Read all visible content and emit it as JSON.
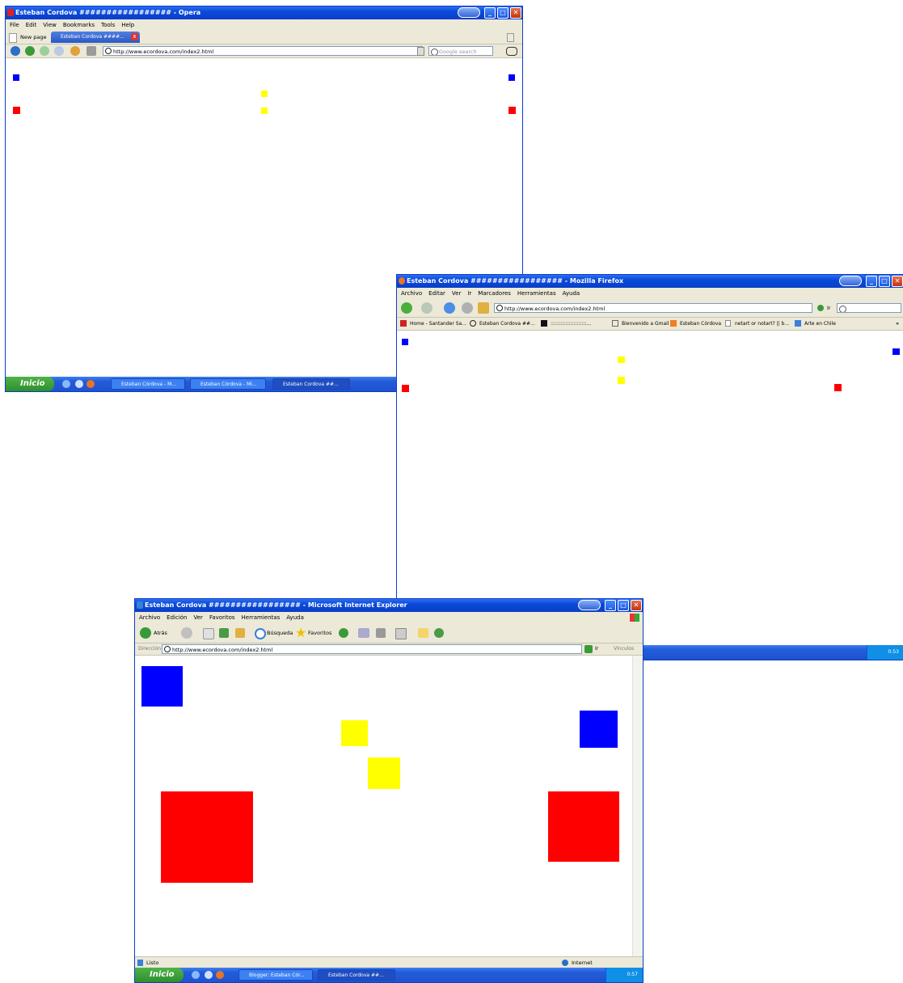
{
  "colors": {
    "blue": "#0000ff",
    "red": "#ff0000",
    "yellow": "#ffff00",
    "xp_title": "#0a49d8",
    "xp_start": "#2e8f2c"
  },
  "opera": {
    "title": "Esteban Cordova ################# - Opera",
    "menu": [
      "File",
      "Edit",
      "View",
      "Bookmarks",
      "Tools",
      "Help"
    ],
    "tabs": {
      "new_page": "New page",
      "active": "Esteban Cordova ####..."
    },
    "address": "http://www.ecordova.com/index2.html",
    "search_placeholder": "Google search",
    "taskbar": {
      "start": "Inicio",
      "items": [
        "Esteban Córdova - M...",
        "Esteban Córdova - Mi...",
        "Esteban Cordova ##..."
      ]
    }
  },
  "firefox": {
    "title": "Esteban Cordova ################# - Mozilla Firefox",
    "menu": [
      "Archivo",
      "Editar",
      "Ver",
      "Ir",
      "Marcadores",
      "Herramientas",
      "Ayuda"
    ],
    "address": "http://www.ecordova.com/index2.html",
    "go_label": "Ir",
    "bookmarks": [
      "Home - Santander Sa...",
      "Esteban Cordova ##...",
      "::::::::::::::::::::::...",
      "Bienvenido a Gmail",
      "Esteban Córdova",
      "netart or notart? || b...",
      "Arte en Chile"
    ],
    "taskbar": {
      "clock": "0:53"
    }
  },
  "ie": {
    "title": "Esteban Cordova ################# - Microsoft Internet Explorer",
    "menu": [
      "Archivo",
      "Edición",
      "Ver",
      "Favoritos",
      "Herramientas",
      "Ayuda"
    ],
    "toolbar": {
      "back": "Atrás",
      "search": "Búsqueda",
      "favorites": "Favoritos"
    },
    "address_label": "Dirección",
    "address": "http://www.ecordova.com/index2.html",
    "go_label": "Ir",
    "links_label": "Vínculos",
    "status": {
      "left": "Listo",
      "right": "Internet"
    },
    "taskbar": {
      "start": "Inicio",
      "items": [
        "Blogger: Esteban Cór...",
        "Esteban Cordova ##..."
      ],
      "clock": "0:57"
    }
  }
}
